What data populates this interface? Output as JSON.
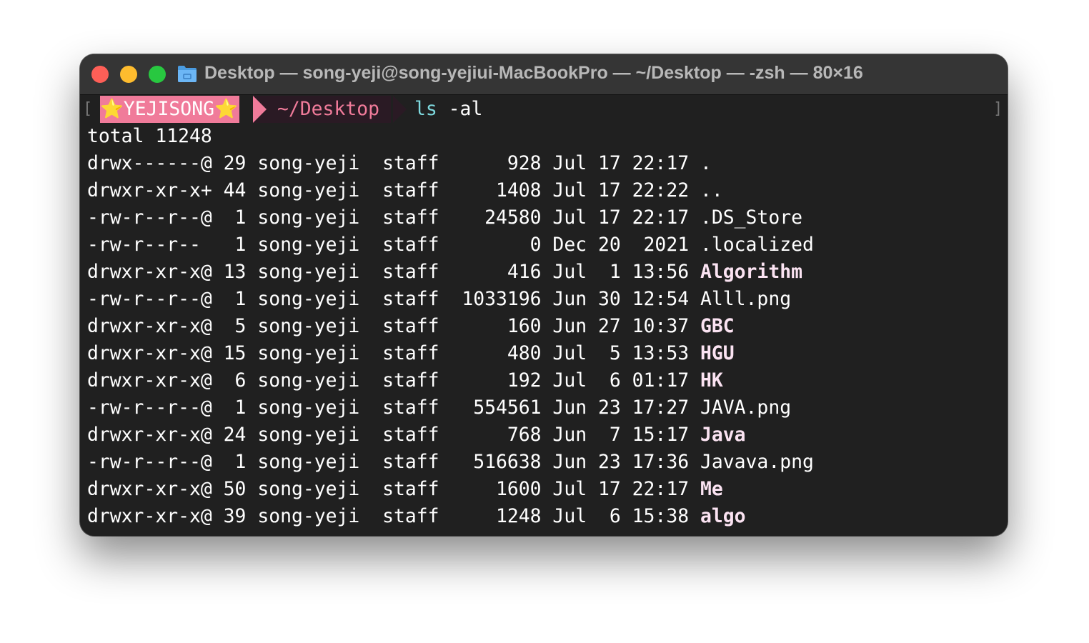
{
  "window": {
    "title": "Desktop — song-yeji@song-yejiui-MacBookPro — ~/Desktop — -zsh — 80×16",
    "folder_icon": "folder-icon",
    "colors": {
      "background": "#202020",
      "titlebar": "#353535",
      "prompt_user_bg": "#f07b9a",
      "prompt_dir_fg": "#f07b9a",
      "command": "#7fdbe0"
    }
  },
  "prompt": {
    "open_bracket": "[",
    "close_bracket": "]",
    "user": "⭐YEJISONG⭐",
    "dir": "~/Desktop",
    "command": "ls",
    "args": " -al"
  },
  "output": {
    "total": "total 11248",
    "rows": [
      {
        "meta": "drwx------@ 29 song-yeji  staff      928 Jul 17 22:17 ",
        "name": ".",
        "is_dir": false
      },
      {
        "meta": "drwxr-xr-x+ 44 song-yeji  staff     1408 Jul 17 22:22 ",
        "name": "..",
        "is_dir": false
      },
      {
        "meta": "-rw-r--r--@  1 song-yeji  staff    24580 Jul 17 22:17 ",
        "name": ".DS_Store",
        "is_dir": false
      },
      {
        "meta": "-rw-r--r--   1 song-yeji  staff        0 Dec 20  2021 ",
        "name": ".localized",
        "is_dir": false
      },
      {
        "meta": "drwxr-xr-x@ 13 song-yeji  staff      416 Jul  1 13:56 ",
        "name": "Algorithm",
        "is_dir": true
      },
      {
        "meta": "-rw-r--r--@  1 song-yeji  staff  1033196 Jun 30 12:54 ",
        "name": "Alll.png",
        "is_dir": false
      },
      {
        "meta": "drwxr-xr-x@  5 song-yeji  staff      160 Jun 27 10:37 ",
        "name": "GBC",
        "is_dir": true
      },
      {
        "meta": "drwxr-xr-x@ 15 song-yeji  staff      480 Jul  5 13:53 ",
        "name": "HGU",
        "is_dir": true
      },
      {
        "meta": "drwxr-xr-x@  6 song-yeji  staff      192 Jul  6 01:17 ",
        "name": "HK",
        "is_dir": true
      },
      {
        "meta": "-rw-r--r--@  1 song-yeji  staff   554561 Jun 23 17:27 ",
        "name": "JAVA.png",
        "is_dir": false
      },
      {
        "meta": "drwxr-xr-x@ 24 song-yeji  staff      768 Jun  7 15:17 ",
        "name": "Java",
        "is_dir": true
      },
      {
        "meta": "-rw-r--r--@  1 song-yeji  staff   516638 Jun 23 17:36 ",
        "name": "Javava.png",
        "is_dir": false
      },
      {
        "meta": "drwxr-xr-x@ 50 song-yeji  staff     1600 Jul 17 22:17 ",
        "name": "Me",
        "is_dir": true
      },
      {
        "meta": "drwxr-xr-x@ 39 song-yeji  staff     1248 Jul  6 15:38 ",
        "name": "algo",
        "is_dir": true
      }
    ]
  }
}
